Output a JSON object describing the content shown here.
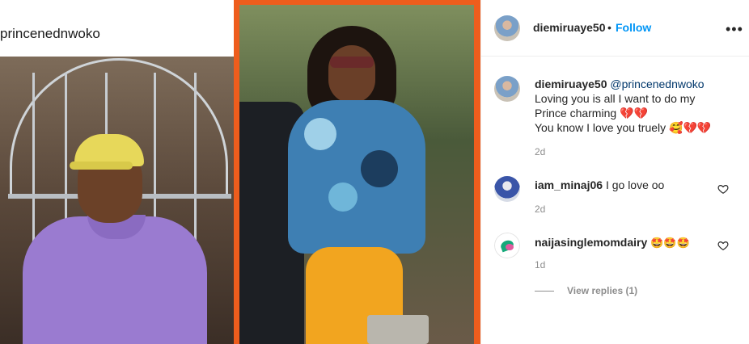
{
  "media": {
    "left_panel_caption": "princenednwoko"
  },
  "post_header": {
    "username": "diemiruaye50",
    "separator": "•",
    "follow_label": "Follow",
    "more_icon": "more-horizontal-icon"
  },
  "comments": [
    {
      "username": "diemiruaye50",
      "mention": "@princenednwoko",
      "line1": "Loving you is all I want to do my",
      "line2": "Prince charming 💔💔",
      "line3": "You know I love you truely 🥰💔💔",
      "time": "2d"
    },
    {
      "username": "iam_minaj06",
      "text": "I go love oo",
      "time": "2d"
    },
    {
      "username": "naijasinglemomdairy",
      "text": "🤩🤩🤩",
      "time": "1d",
      "view_replies": "View replies (1)"
    }
  ],
  "colors": {
    "background_orange": "#ee5d1d",
    "link_blue": "#0095f6",
    "muted_gray": "#8e8e8e"
  }
}
